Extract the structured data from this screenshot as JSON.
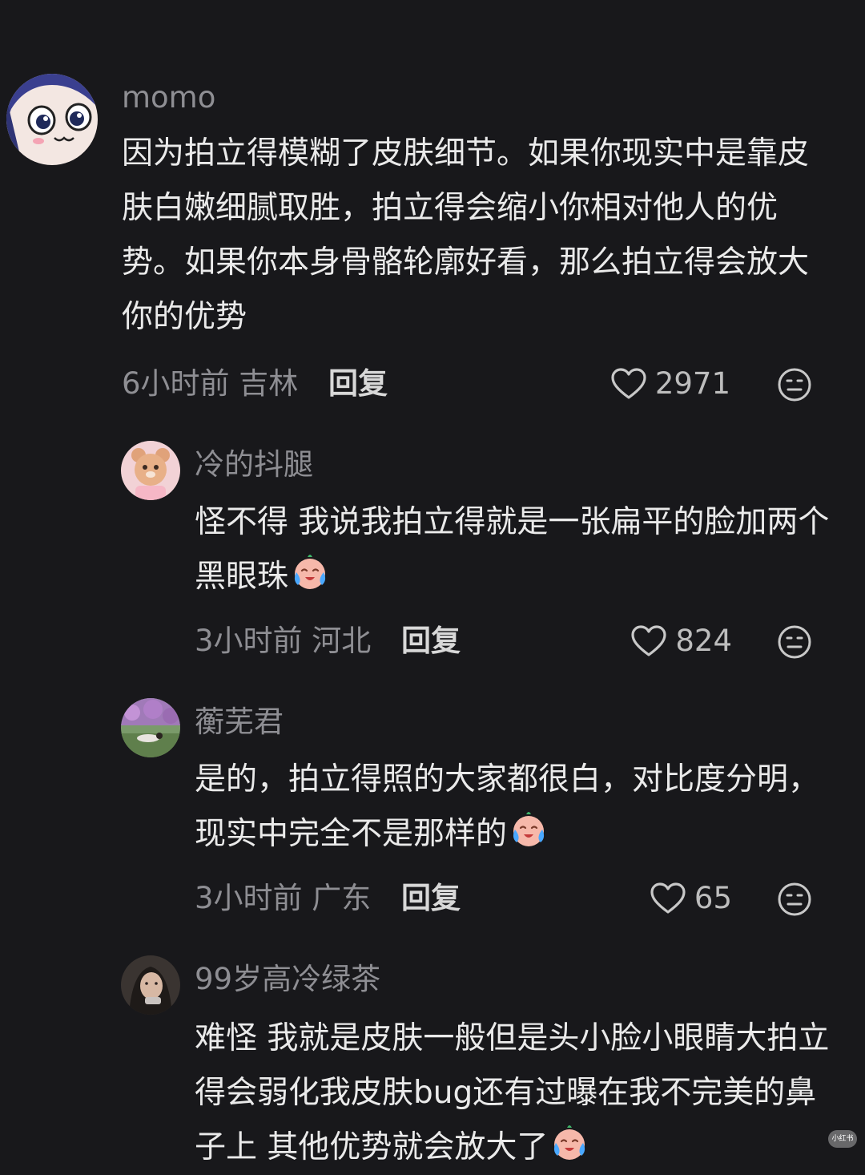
{
  "comments": [
    {
      "username": "momo",
      "text": "因为拍立得模糊了皮肤细节。如果你现实中是靠皮肤白嫩细腻取胜，拍立得会缩小你相对他人的优势。如果你本身骨骼轮廓好看，那么拍立得会放大你的优势",
      "time_location": "6小时前 吉林",
      "reply_label": "回复",
      "likes": "2971"
    },
    {
      "username": "冷的抖腿",
      "text": "怪不得 我说我拍立得就是一张扁平的脸加两个黑眼珠",
      "emoji": "crying-face-emoji",
      "time_location": "3小时前 河北",
      "reply_label": "回复",
      "likes": "824"
    },
    {
      "username": "蘅芜君",
      "text": "是的，拍立得照的大家都很白，对比度分明，现实中完全不是那样的",
      "emoji": "crying-face-emoji",
      "time_location": "3小时前 广东",
      "reply_label": "回复",
      "likes": "65"
    },
    {
      "username": "99岁高冷绿茶",
      "text": "难怪 我就是皮肤一般但是头小脸小眼睛大拍立得会弱化我皮肤bug还有过曝在我不完美的鼻子上 其他优势就会放大了",
      "emoji": "crying-face-emoji"
    }
  ],
  "icons": {
    "like": "heart-icon",
    "react": "neutral-face-icon"
  },
  "colors": {
    "background": "#18181b",
    "text": "#eaeaea",
    "secondary_text": "#8e8e93"
  },
  "watermark": "小红书"
}
